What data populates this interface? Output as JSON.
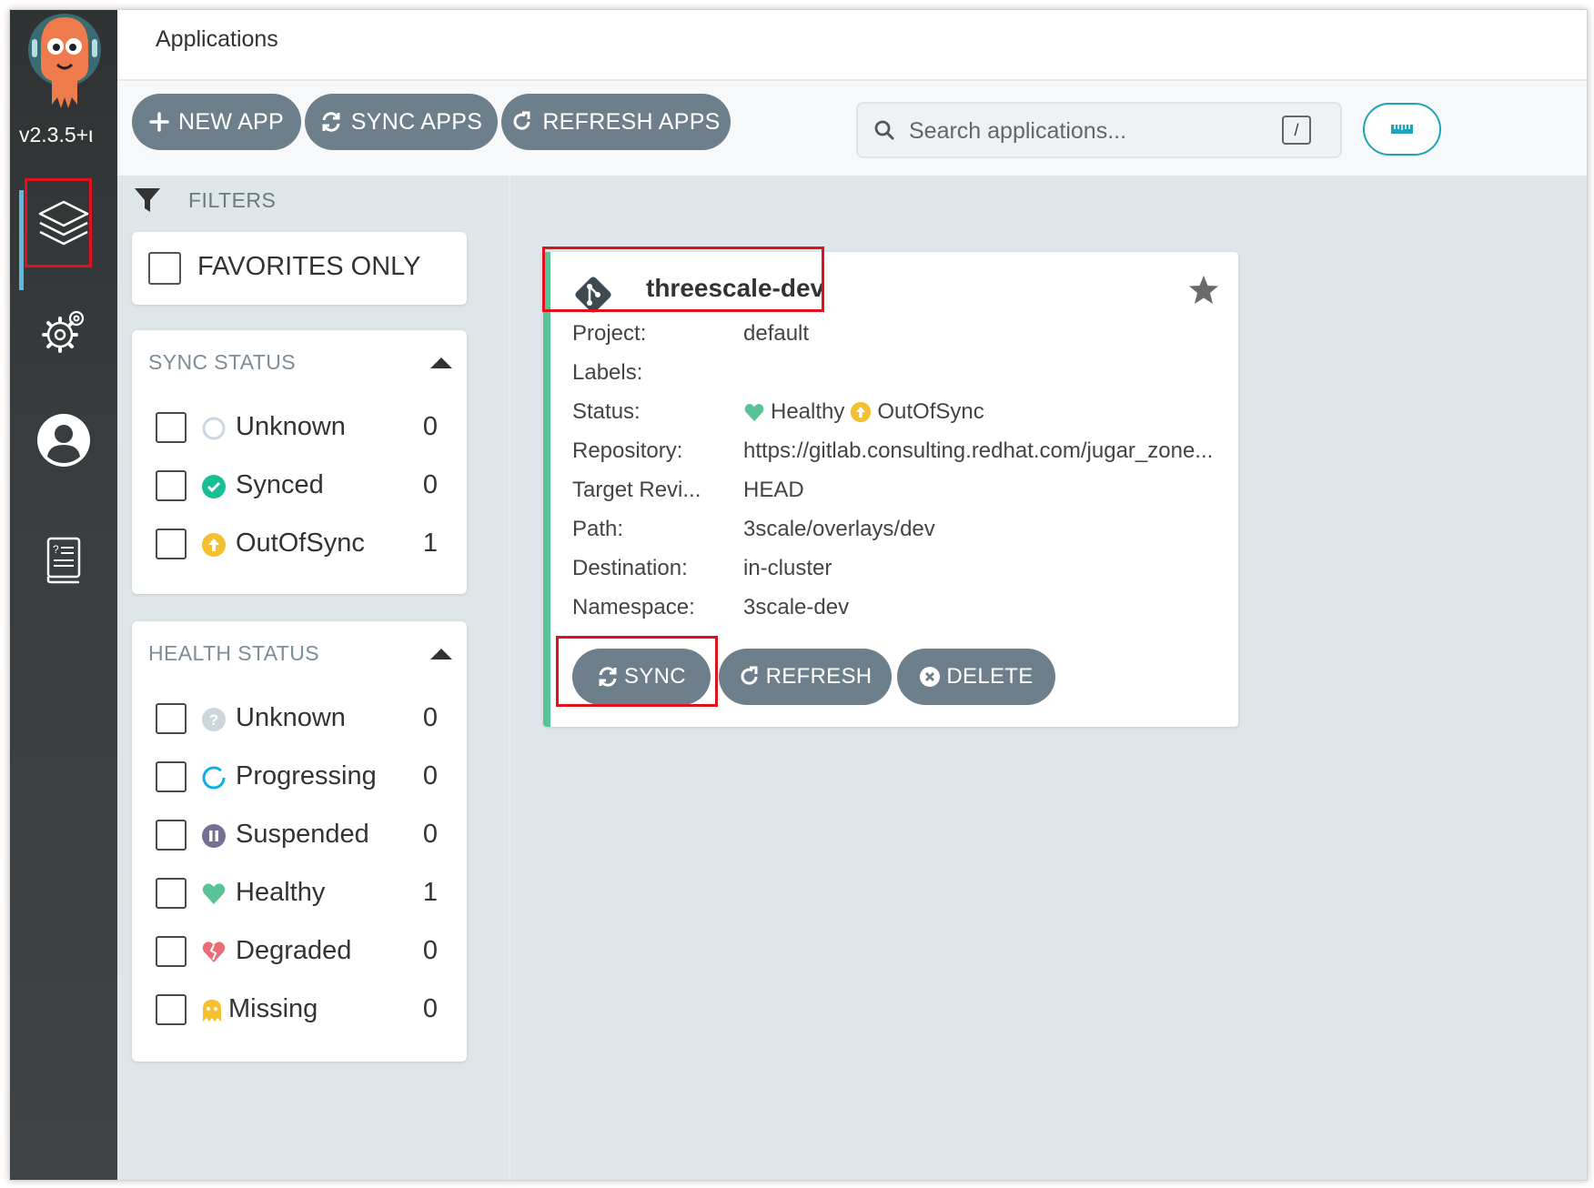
{
  "sidebar": {
    "version": "v2.3.5+ι",
    "nav": [
      {
        "name": "applications"
      },
      {
        "name": "settings"
      },
      {
        "name": "user-info"
      },
      {
        "name": "documentation"
      }
    ]
  },
  "header": {
    "title": "Applications"
  },
  "toolbar": {
    "new_app": "NEW APP",
    "sync_apps": "SYNC APPS",
    "refresh_apps": "REFRESH APPS",
    "search_placeholder": "Search applications...",
    "search_shortcut": "/"
  },
  "filters": {
    "header": "FILTERS",
    "favorites_only": "FAVORITES ONLY",
    "sync_status": {
      "title": "SYNC STATUS",
      "items": [
        {
          "label": "Unknown",
          "count": "0"
        },
        {
          "label": "Synced",
          "count": "0"
        },
        {
          "label": "OutOfSync",
          "count": "1"
        }
      ]
    },
    "health_status": {
      "title": "HEALTH STATUS",
      "items": [
        {
          "label": "Unknown",
          "count": "0"
        },
        {
          "label": "Progressing",
          "count": "0"
        },
        {
          "label": "Suspended",
          "count": "0"
        },
        {
          "label": "Healthy",
          "count": "1"
        },
        {
          "label": "Degraded",
          "count": "0"
        },
        {
          "label": "Missing",
          "count": "0"
        }
      ]
    }
  },
  "app_card": {
    "name": "threescale-dev",
    "fields": [
      {
        "key": "Project:",
        "value": "default"
      },
      {
        "key": "Labels:",
        "value": ""
      },
      {
        "key": "Status:",
        "value": ""
      },
      {
        "key": "Repository:",
        "value": "https://gitlab.consulting.redhat.com/jugar_zone..."
      },
      {
        "key": "Target Revi...",
        "value": "HEAD"
      },
      {
        "key": "Path:",
        "value": "3scale/overlays/dev"
      },
      {
        "key": "Destination:",
        "value": "in-cluster"
      },
      {
        "key": "Namespace:",
        "value": "3scale-dev"
      }
    ],
    "health": "Healthy",
    "sync": "OutOfSync",
    "buttons": {
      "sync": "SYNC",
      "refresh": "REFRESH",
      "delete": "DELETE"
    }
  },
  "colors": {
    "sidebar_bg": "#3a3d3f",
    "button_bg": "#6d7f8b",
    "healthy": "#5ac297",
    "out_of_sync": "#f4c030",
    "highlight": "#e0101c",
    "accent": "#1fa3b8"
  }
}
